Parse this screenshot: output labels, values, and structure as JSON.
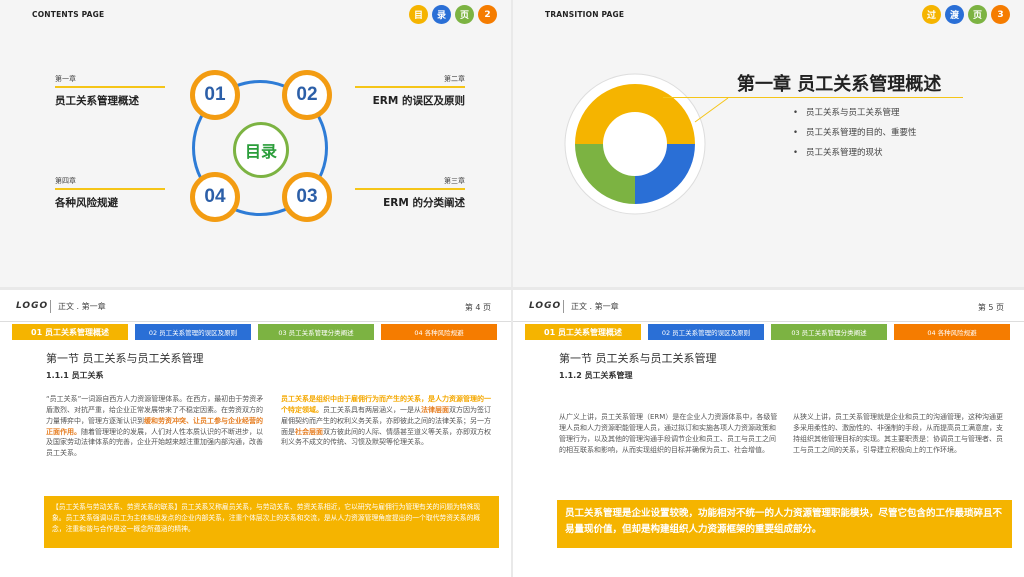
{
  "s1": {
    "header": "CONTENTS PAGE",
    "badges": [
      "目",
      "录",
      "页",
      "2"
    ],
    "center": "目录",
    "nums": [
      "01",
      "02",
      "03",
      "04"
    ],
    "items": [
      {
        "sub": "第一章",
        "main": "员工关系管理概述"
      },
      {
        "sub": "第二章",
        "main": "ERM 的误区及原则"
      },
      {
        "sub": "第三章",
        "main": "ERM 的分类阐述"
      },
      {
        "sub": "第四章",
        "main": "各种风险规避"
      }
    ]
  },
  "s2": {
    "header": "TRANSITION PAGE",
    "badges": [
      "过",
      "渡",
      "页",
      "3"
    ],
    "title": "第一章  员工关系管理概述",
    "bullets": [
      "员工关系与员工关系管理",
      "员工关系管理的目的、重要性",
      "员工关系管理的现状"
    ],
    "donut_colors": [
      "#f5b400",
      "#2a6fd6",
      "#7cb342",
      "#f5b400"
    ]
  },
  "common": {
    "logo": "LOGO",
    "crumb": "正文 . 第一章",
    "tabs": [
      "01 员工关系管理概述",
      "02 员工关系管理的误区及原则",
      "03 员工关系管理分类阐述",
      "04 各种风险规避"
    ]
  },
  "s3": {
    "page": "第 4 页",
    "section": "第一节  员工关系与员工关系管理",
    "subsection": "1.1.1 员工关系",
    "left_a": "“员工关系”一词源自西方人力资源管理体系。在西方，最初由于劳资矛盾激烈、对抗严重，给企业正常发展带来了不稳定因素。在劳资双方的力量博弈中，管理方逐渐认识到",
    "left_hl1": "缓和劳资冲突、让员工参与企业经营的正面作用。",
    "left_b": "随着管理理论的发展，人们对人性本质认识的不断进步，以及国家劳动法律体系的完善，企业开始越来越注重加强内部沟通，改善员工关系。",
    "right_hl1": "员工关系是组织中由于雇佣行为而产生的关系，是人力资源管理的一个特定领域。",
    "right_a": "员工关系具有两层涵义，一是从",
    "right_hl2": "法律层面",
    "right_b": "双方因为签订雇佣契约而产生的权利义务关系，亦即彼此之间的法律关系；另一方面是",
    "right_hl3": "社会层面",
    "right_c": "双方彼此间的人际、情感甚至道义等关系，亦即双方权利义务不成文的传统、习惯及默契等伦理关系。",
    "box": "【员工关系与劳动关系、劳资关系的联系】员工关系又称雇员关系，与劳动关系、劳资关系相近，它以研究与雇佣行为管理有关的问题为特殊现象。员工关系强调以员工为主体和出发点的企业内部关系，注重个体层次上的关系和交流，是从人力资源管理角度提出的一个取代劳资关系的概念，注重和谐与合作是这一概念所蕴涵的精神。"
  },
  "s4": {
    "page": "第 5 页",
    "section": "第一节  员工关系与员工关系管理",
    "subsection": "1.1.2 员工关系管理",
    "left": "从广义上讲，员工关系管理（ERM）是在企业人力资源体系中，各级管理人员和人力资源职能管理人员，通过拟订和实施各项人力资源政策和管理行为，以及其他的管理沟通手段调节企业和员工、员工与员工之间的相互联系和影响，从而实现组织的目标并确保为员工、社会增值。",
    "right": "从狭义上讲，员工关系管理就是企业和员工的沟通管理，这种沟通更多采用柔性的、激励性的、非强制的手段，从而提高员工满意度，支持组织其他管理目标的实现。其主要职责是：协调员工与管理者、员工与员工之间的关系，引导建立积极向上的工作环境。",
    "box": "员工关系管理是企业设置较晚，功能相对不统一的人力资源管理职能模块，尽管它包含的工作最琐碎且不易量现价值，但却是构建组织人力资源框架的重要组成部分。"
  }
}
